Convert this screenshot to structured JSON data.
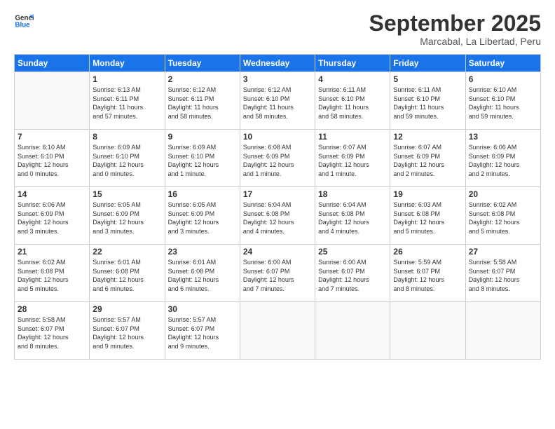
{
  "logo": {
    "line1": "General",
    "line2": "Blue"
  },
  "title": "September 2025",
  "subtitle": "Marcabal, La Libertad, Peru",
  "days_of_week": [
    "Sunday",
    "Monday",
    "Tuesday",
    "Wednesday",
    "Thursday",
    "Friday",
    "Saturday"
  ],
  "weeks": [
    [
      {
        "day": "",
        "info": ""
      },
      {
        "day": "1",
        "info": "Sunrise: 6:13 AM\nSunset: 6:11 PM\nDaylight: 11 hours\nand 57 minutes."
      },
      {
        "day": "2",
        "info": "Sunrise: 6:12 AM\nSunset: 6:11 PM\nDaylight: 11 hours\nand 58 minutes."
      },
      {
        "day": "3",
        "info": "Sunrise: 6:12 AM\nSunset: 6:10 PM\nDaylight: 11 hours\nand 58 minutes."
      },
      {
        "day": "4",
        "info": "Sunrise: 6:11 AM\nSunset: 6:10 PM\nDaylight: 11 hours\nand 58 minutes."
      },
      {
        "day": "5",
        "info": "Sunrise: 6:11 AM\nSunset: 6:10 PM\nDaylight: 11 hours\nand 59 minutes."
      },
      {
        "day": "6",
        "info": "Sunrise: 6:10 AM\nSunset: 6:10 PM\nDaylight: 11 hours\nand 59 minutes."
      }
    ],
    [
      {
        "day": "7",
        "info": "Sunrise: 6:10 AM\nSunset: 6:10 PM\nDaylight: 12 hours\nand 0 minutes."
      },
      {
        "day": "8",
        "info": "Sunrise: 6:09 AM\nSunset: 6:10 PM\nDaylight: 12 hours\nand 0 minutes."
      },
      {
        "day": "9",
        "info": "Sunrise: 6:09 AM\nSunset: 6:10 PM\nDaylight: 12 hours\nand 1 minute."
      },
      {
        "day": "10",
        "info": "Sunrise: 6:08 AM\nSunset: 6:09 PM\nDaylight: 12 hours\nand 1 minute."
      },
      {
        "day": "11",
        "info": "Sunrise: 6:07 AM\nSunset: 6:09 PM\nDaylight: 12 hours\nand 1 minute."
      },
      {
        "day": "12",
        "info": "Sunrise: 6:07 AM\nSunset: 6:09 PM\nDaylight: 12 hours\nand 2 minutes."
      },
      {
        "day": "13",
        "info": "Sunrise: 6:06 AM\nSunset: 6:09 PM\nDaylight: 12 hours\nand 2 minutes."
      }
    ],
    [
      {
        "day": "14",
        "info": "Sunrise: 6:06 AM\nSunset: 6:09 PM\nDaylight: 12 hours\nand 3 minutes."
      },
      {
        "day": "15",
        "info": "Sunrise: 6:05 AM\nSunset: 6:09 PM\nDaylight: 12 hours\nand 3 minutes."
      },
      {
        "day": "16",
        "info": "Sunrise: 6:05 AM\nSunset: 6:09 PM\nDaylight: 12 hours\nand 3 minutes."
      },
      {
        "day": "17",
        "info": "Sunrise: 6:04 AM\nSunset: 6:08 PM\nDaylight: 12 hours\nand 4 minutes."
      },
      {
        "day": "18",
        "info": "Sunrise: 6:04 AM\nSunset: 6:08 PM\nDaylight: 12 hours\nand 4 minutes."
      },
      {
        "day": "19",
        "info": "Sunrise: 6:03 AM\nSunset: 6:08 PM\nDaylight: 12 hours\nand 5 minutes."
      },
      {
        "day": "20",
        "info": "Sunrise: 6:02 AM\nSunset: 6:08 PM\nDaylight: 12 hours\nand 5 minutes."
      }
    ],
    [
      {
        "day": "21",
        "info": "Sunrise: 6:02 AM\nSunset: 6:08 PM\nDaylight: 12 hours\nand 5 minutes."
      },
      {
        "day": "22",
        "info": "Sunrise: 6:01 AM\nSunset: 6:08 PM\nDaylight: 12 hours\nand 6 minutes."
      },
      {
        "day": "23",
        "info": "Sunrise: 6:01 AM\nSunset: 6:08 PM\nDaylight: 12 hours\nand 6 minutes."
      },
      {
        "day": "24",
        "info": "Sunrise: 6:00 AM\nSunset: 6:07 PM\nDaylight: 12 hours\nand 7 minutes."
      },
      {
        "day": "25",
        "info": "Sunrise: 6:00 AM\nSunset: 6:07 PM\nDaylight: 12 hours\nand 7 minutes."
      },
      {
        "day": "26",
        "info": "Sunrise: 5:59 AM\nSunset: 6:07 PM\nDaylight: 12 hours\nand 8 minutes."
      },
      {
        "day": "27",
        "info": "Sunrise: 5:58 AM\nSunset: 6:07 PM\nDaylight: 12 hours\nand 8 minutes."
      }
    ],
    [
      {
        "day": "28",
        "info": "Sunrise: 5:58 AM\nSunset: 6:07 PM\nDaylight: 12 hours\nand 8 minutes."
      },
      {
        "day": "29",
        "info": "Sunrise: 5:57 AM\nSunset: 6:07 PM\nDaylight: 12 hours\nand 9 minutes."
      },
      {
        "day": "30",
        "info": "Sunrise: 5:57 AM\nSunset: 6:07 PM\nDaylight: 12 hours\nand 9 minutes."
      },
      {
        "day": "",
        "info": ""
      },
      {
        "day": "",
        "info": ""
      },
      {
        "day": "",
        "info": ""
      },
      {
        "day": "",
        "info": ""
      }
    ]
  ]
}
